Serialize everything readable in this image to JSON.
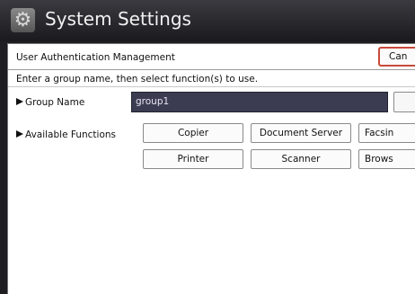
{
  "window": {
    "title": "System Settings",
    "icon": "gear-icon"
  },
  "header": {
    "section_title": "User Authentication Management",
    "cancel_label": "Can"
  },
  "instruction": "Enter a group name, then select function(s) to use.",
  "group": {
    "label": "Group Name",
    "value": "group1"
  },
  "functions": {
    "label": "Available Functions",
    "row1": [
      "Copier",
      "Document Server",
      "Facsin"
    ],
    "row2": [
      "Printer",
      "Scanner",
      "Brows"
    ]
  }
}
